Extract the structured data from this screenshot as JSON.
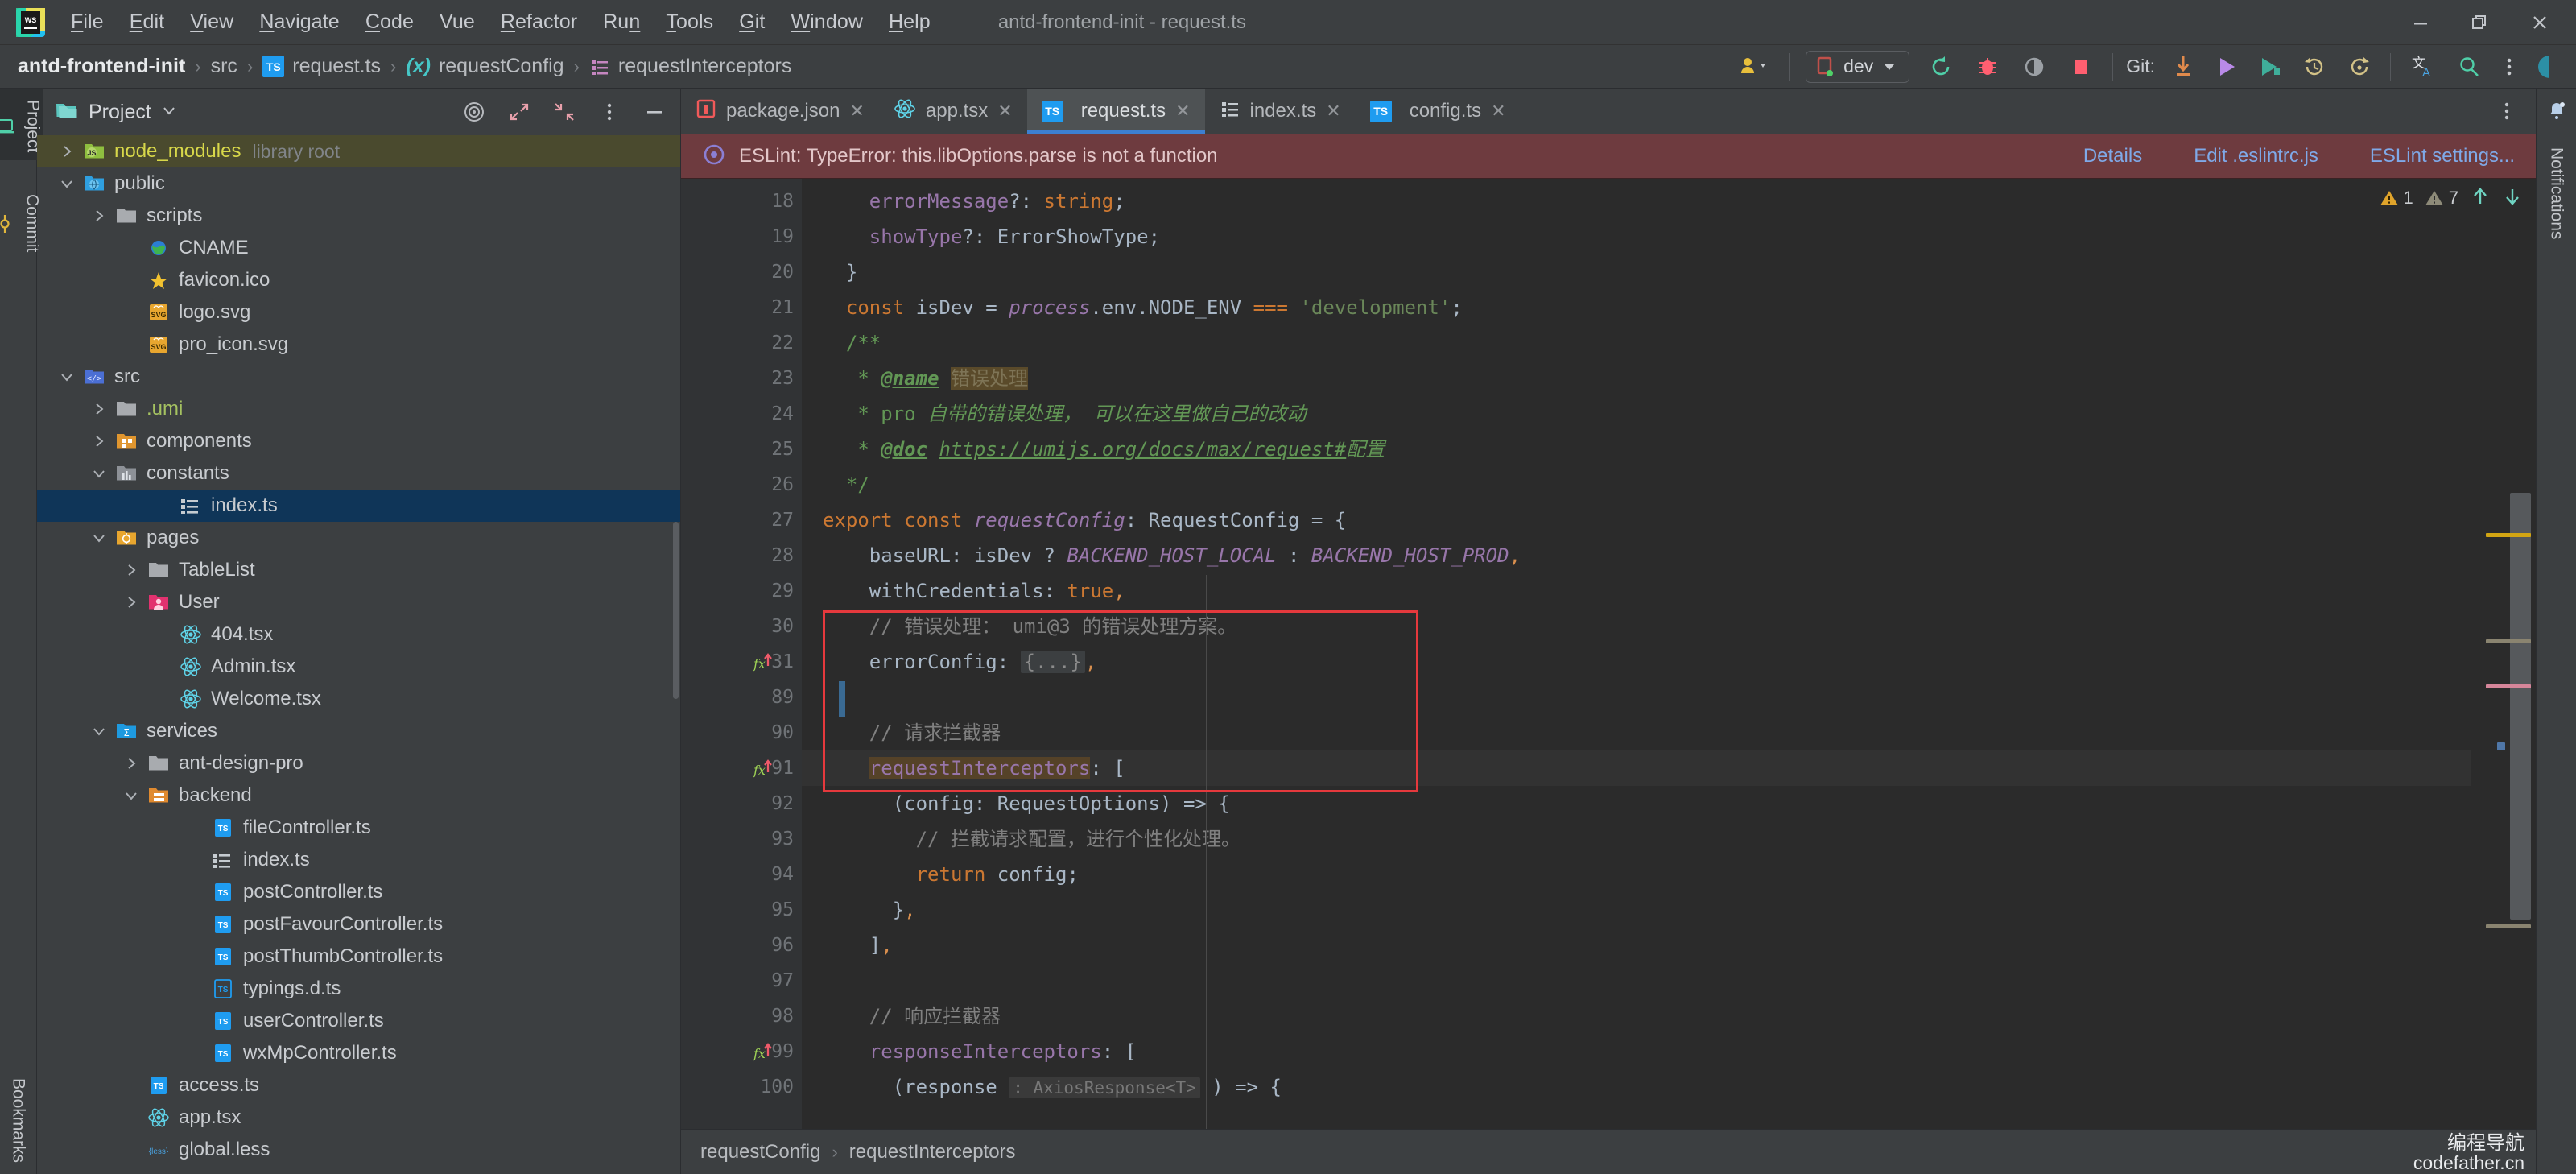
{
  "window": {
    "title": "antd-frontend-init - request.ts",
    "controls": [
      "minimize",
      "restore",
      "close"
    ]
  },
  "menu": {
    "items": [
      {
        "label": "File",
        "mnemonic": "F"
      },
      {
        "label": "Edit",
        "mnemonic": "E"
      },
      {
        "label": "View",
        "mnemonic": "V"
      },
      {
        "label": "Navigate",
        "mnemonic": "N"
      },
      {
        "label": "Code",
        "mnemonic": "C"
      },
      {
        "label": "Vue",
        "mnemonic": ""
      },
      {
        "label": "Refactor",
        "mnemonic": "R"
      },
      {
        "label": "Run",
        "mnemonic": "n"
      },
      {
        "label": "Tools",
        "mnemonic": "T"
      },
      {
        "label": "Git",
        "mnemonic": "G"
      },
      {
        "label": "Window",
        "mnemonic": "W"
      },
      {
        "label": "Help",
        "mnemonic": "H"
      }
    ]
  },
  "breadcrumb": {
    "items": [
      {
        "label": "antd-frontend-init",
        "icon": "none",
        "bold": true
      },
      {
        "label": "src",
        "icon": "none",
        "bold": false
      },
      {
        "label": "request.ts",
        "icon": "ts-file-icon",
        "bold": false
      },
      {
        "label": "requestConfig",
        "icon": "variable-icon",
        "bold": false
      },
      {
        "label": "requestInterceptors",
        "icon": "property-list-icon",
        "bold": false
      }
    ],
    "separator": "›"
  },
  "toolbar": {
    "run_config": "dev",
    "git_label": "Git:",
    "buttons": [
      {
        "name": "account-icon",
        "title": "Account"
      },
      {
        "name": "run-config-selector",
        "title": "dev"
      },
      {
        "name": "rerun-icon",
        "title": "Rerun"
      },
      {
        "name": "debug-icon",
        "title": "Debug"
      },
      {
        "name": "run-with-coverage-icon",
        "title": "Run with Coverage"
      },
      {
        "name": "stop-icon",
        "title": "Stop"
      },
      {
        "name": "git-update-project-icon",
        "title": "Update Project"
      },
      {
        "name": "git-commit-icon",
        "title": "Commit"
      },
      {
        "name": "git-push-icon",
        "title": "Push"
      },
      {
        "name": "git-history-icon",
        "title": "History"
      },
      {
        "name": "git-rollback-icon",
        "title": "Rollback"
      },
      {
        "name": "translate-icon",
        "title": "Translate"
      },
      {
        "name": "search-everywhere-icon",
        "title": "Search"
      },
      {
        "name": "more-options-icon",
        "title": "More"
      },
      {
        "name": "ide-assistant-icon",
        "title": "Assistant"
      }
    ]
  },
  "left_rail": {
    "tabs": [
      {
        "label": "Project",
        "icon": "project-icon",
        "active": true
      },
      {
        "label": "Commit",
        "icon": "commit-icon",
        "active": false
      },
      {
        "label": "Bookmarks",
        "icon": "bookmarks-icon",
        "active": false
      }
    ]
  },
  "right_rail": {
    "tabs": [
      {
        "label": "Notifications",
        "icon": "bell-icon",
        "active": false
      }
    ]
  },
  "project_panel": {
    "title": "Project",
    "header_icons": [
      {
        "name": "select-opened-file-icon"
      },
      {
        "name": "expand-all-icon"
      },
      {
        "name": "collapse-all-icon"
      },
      {
        "name": "panel-options-icon"
      },
      {
        "name": "hide-panel-icon"
      }
    ],
    "tree": [
      {
        "label": "node_modules",
        "sub": "library root",
        "indent": 1,
        "arrow": "collapsed",
        "icon": "folder-js-icon",
        "color": "yellow",
        "state": "olive"
      },
      {
        "label": "public",
        "sub": "",
        "indent": 1,
        "arrow": "expanded",
        "icon": "folder-web-icon",
        "color": "",
        "state": ""
      },
      {
        "label": "scripts",
        "sub": "",
        "indent": 2,
        "arrow": "collapsed",
        "icon": "folder-gray-icon",
        "color": "",
        "state": ""
      },
      {
        "label": "CNAME",
        "sub": "",
        "indent": 3,
        "arrow": "none",
        "icon": "globe-icon",
        "color": "",
        "state": ""
      },
      {
        "label": "favicon.ico",
        "sub": "",
        "indent": 3,
        "arrow": "none",
        "icon": "star-icon",
        "color": "",
        "state": ""
      },
      {
        "label": "logo.svg",
        "sub": "",
        "indent": 3,
        "arrow": "none",
        "icon": "svg-icon",
        "color": "",
        "state": ""
      },
      {
        "label": "pro_icon.svg",
        "sub": "",
        "indent": 3,
        "arrow": "none",
        "icon": "svg-icon",
        "color": "",
        "state": ""
      },
      {
        "label": "src",
        "sub": "",
        "indent": 1,
        "arrow": "expanded",
        "icon": "folder-src-icon",
        "color": "",
        "state": ""
      },
      {
        "label": ".umi",
        "sub": "",
        "indent": 2,
        "arrow": "collapsed",
        "icon": "folder-gray-icon",
        "color": "green",
        "state": ""
      },
      {
        "label": "components",
        "sub": "",
        "indent": 2,
        "arrow": "collapsed",
        "icon": "folder-components-icon",
        "color": "",
        "state": ""
      },
      {
        "label": "constants",
        "sub": "",
        "indent": 2,
        "arrow": "expanded",
        "icon": "folder-constants-icon",
        "color": "",
        "state": ""
      },
      {
        "label": "index.ts",
        "sub": "",
        "indent": 4,
        "arrow": "none",
        "icon": "list-file-icon",
        "color": "",
        "state": "selected"
      },
      {
        "label": "pages",
        "sub": "",
        "indent": 2,
        "arrow": "expanded",
        "icon": "folder-pages-icon",
        "color": "",
        "state": ""
      },
      {
        "label": "TableList",
        "sub": "",
        "indent": 3,
        "arrow": "collapsed",
        "icon": "folder-gray-icon",
        "color": "",
        "state": ""
      },
      {
        "label": "User",
        "sub": "",
        "indent": 3,
        "arrow": "collapsed",
        "icon": "folder-user-icon",
        "color": "",
        "state": ""
      },
      {
        "label": "404.tsx",
        "sub": "",
        "indent": 4,
        "arrow": "none",
        "icon": "react-icon",
        "color": "",
        "state": ""
      },
      {
        "label": "Admin.tsx",
        "sub": "",
        "indent": 4,
        "arrow": "none",
        "icon": "react-icon",
        "color": "",
        "state": ""
      },
      {
        "label": "Welcome.tsx",
        "sub": "",
        "indent": 4,
        "arrow": "none",
        "icon": "react-icon",
        "color": "",
        "state": ""
      },
      {
        "label": "services",
        "sub": "",
        "indent": 2,
        "arrow": "expanded",
        "icon": "folder-services-icon",
        "color": "",
        "state": ""
      },
      {
        "label": "ant-design-pro",
        "sub": "",
        "indent": 3,
        "arrow": "collapsed",
        "icon": "folder-gray-icon",
        "color": "",
        "state": ""
      },
      {
        "label": "backend",
        "sub": "",
        "indent": 3,
        "arrow": "expanded",
        "icon": "folder-backend-icon",
        "color": "",
        "state": ""
      },
      {
        "label": "fileController.ts",
        "sub": "",
        "indent": 5,
        "arrow": "none",
        "icon": "ts-file-icon",
        "color": "",
        "state": ""
      },
      {
        "label": "index.ts",
        "sub": "",
        "indent": 5,
        "arrow": "none",
        "icon": "list-file-icon",
        "color": "",
        "state": ""
      },
      {
        "label": "postController.ts",
        "sub": "",
        "indent": 5,
        "arrow": "none",
        "icon": "ts-file-icon",
        "color": "",
        "state": ""
      },
      {
        "label": "postFavourController.ts",
        "sub": "",
        "indent": 5,
        "arrow": "none",
        "icon": "ts-file-icon",
        "color": "",
        "state": ""
      },
      {
        "label": "postThumbController.ts",
        "sub": "",
        "indent": 5,
        "arrow": "none",
        "icon": "ts-file-icon",
        "color": "",
        "state": ""
      },
      {
        "label": "typings.d.ts",
        "sub": "",
        "indent": 5,
        "arrow": "none",
        "icon": "ts-declaration-icon",
        "color": "",
        "state": ""
      },
      {
        "label": "userController.ts",
        "sub": "",
        "indent": 5,
        "arrow": "none",
        "icon": "ts-file-icon",
        "color": "",
        "state": ""
      },
      {
        "label": "wxMpController.ts",
        "sub": "",
        "indent": 5,
        "arrow": "none",
        "icon": "ts-file-icon",
        "color": "",
        "state": ""
      },
      {
        "label": "access.ts",
        "sub": "",
        "indent": 3,
        "arrow": "none",
        "icon": "ts-file-icon",
        "color": "",
        "state": ""
      },
      {
        "label": "app.tsx",
        "sub": "",
        "indent": 3,
        "arrow": "none",
        "icon": "react-icon",
        "color": "",
        "state": ""
      },
      {
        "label": "global.less",
        "sub": "",
        "indent": 3,
        "arrow": "none",
        "icon": "less-icon",
        "color": "",
        "state": ""
      }
    ]
  },
  "editor_tabs": [
    {
      "label": "package.json",
      "icon": "json-icon",
      "active": false
    },
    {
      "label": "app.tsx",
      "icon": "react-icon",
      "active": false
    },
    {
      "label": "request.ts",
      "icon": "ts-file-icon",
      "active": true
    },
    {
      "label": "index.ts",
      "icon": "list-file-icon",
      "active": false
    },
    {
      "label": "config.ts",
      "icon": "ts-file-icon",
      "active": false
    }
  ],
  "banner": {
    "icon": "eslint-error-icon",
    "message": "ESLint: TypeError: this.libOptions.parse is not a function",
    "links": [
      "Details",
      "Edit .eslintrc.js",
      "ESLint settings..."
    ]
  },
  "inspections": {
    "error_count": "1",
    "warning_count": "7",
    "prev_label": "Previous",
    "next_label": "Next"
  },
  "code": {
    "lines": [
      {
        "num": "18",
        "fold": "",
        "gutter": "",
        "highlight": false
      },
      {
        "num": "19",
        "fold": "",
        "gutter": "",
        "highlight": false
      },
      {
        "num": "20",
        "fold": "end",
        "gutter": "",
        "highlight": false
      },
      {
        "num": "21",
        "fold": "",
        "gutter": "",
        "highlight": false
      },
      {
        "num": "22",
        "fold": "start",
        "gutter": "",
        "highlight": false
      },
      {
        "num": "23",
        "fold": "",
        "gutter": "",
        "highlight": false
      },
      {
        "num": "24",
        "fold": "",
        "gutter": "",
        "highlight": false
      },
      {
        "num": "25",
        "fold": "",
        "gutter": "",
        "highlight": false
      },
      {
        "num": "26",
        "fold": "end",
        "gutter": "",
        "highlight": false
      },
      {
        "num": "27",
        "fold": "start",
        "gutter": "",
        "highlight": false
      },
      {
        "num": "28",
        "fold": "",
        "gutter": "",
        "highlight": false
      },
      {
        "num": "29",
        "fold": "",
        "gutter": "",
        "highlight": false
      },
      {
        "num": "30",
        "fold": "",
        "gutter": "",
        "highlight": false
      },
      {
        "num": "31",
        "fold": "collapsed",
        "gutter": "fx-error",
        "highlight": false
      },
      {
        "num": "89",
        "fold": "",
        "gutter": "",
        "highlight": false
      },
      {
        "num": "90",
        "fold": "",
        "gutter": "",
        "highlight": false
      },
      {
        "num": "91",
        "fold": "start",
        "gutter": "fx-error",
        "highlight": true
      },
      {
        "num": "92",
        "fold": "start",
        "gutter": "",
        "highlight": false
      },
      {
        "num": "93",
        "fold": "",
        "gutter": "",
        "highlight": false
      },
      {
        "num": "94",
        "fold": "",
        "gutter": "",
        "highlight": false
      },
      {
        "num": "95",
        "fold": "end",
        "gutter": "",
        "highlight": false
      },
      {
        "num": "96",
        "fold": "end",
        "gutter": "",
        "highlight": false
      },
      {
        "num": "97",
        "fold": "",
        "gutter": "",
        "highlight": false
      },
      {
        "num": "98",
        "fold": "",
        "gutter": "",
        "highlight": false
      },
      {
        "num": "99",
        "fold": "start",
        "gutter": "fx-error",
        "highlight": false
      },
      {
        "num": "100",
        "fold": "start",
        "gutter": "",
        "highlight": false
      }
    ],
    "text": [
      "    errorMessage?: string;",
      "    showType?: ErrorShowType;",
      "  }",
      "  const isDev = process.env.NODE_ENV === 'development';",
      "  /**",
      "   * @name 错误处理",
      "   * pro 自带的错误处理， 可以在这里做自己的改动",
      "   * @doc https://umijs.org/docs/max/request#配置",
      "   */",
      "export const requestConfig: RequestConfig = {",
      "    baseURL: isDev ? BACKEND_HOST_LOCAL : BACKEND_HOST_PROD,",
      "    withCredentials: true,",
      "    // 错误处理： umi@3 的错误处理方案。",
      "    errorConfig: {...},",
      "",
      "    // 请求拦截器",
      "    requestInterceptors: [",
      "      (config: RequestOptions) => {",
      "        // 拦截请求配置，进行个性化处理。",
      "        return config;",
      "      },",
      "    ],",
      "",
      "    // 响应拦截器",
      "    responseInterceptors: [",
      "      (response : AxiosResponse<T> ) => {"
    ]
  },
  "status": {
    "crumbs": [
      "requestConfig",
      "requestInterceptors"
    ],
    "separator": "›"
  },
  "watermark": {
    "line1": "编程导航",
    "line2": "codefather.cn"
  },
  "colors": {
    "accent_blue": "#3d7fd1",
    "error_banner": "#6e3b3f",
    "link_blue": "#7fa9e8",
    "selection_blue": "#0f3558",
    "red_outline": "#e5393d",
    "editor_bg": "#2b2b2b",
    "panel_bg": "#3c3f41"
  }
}
